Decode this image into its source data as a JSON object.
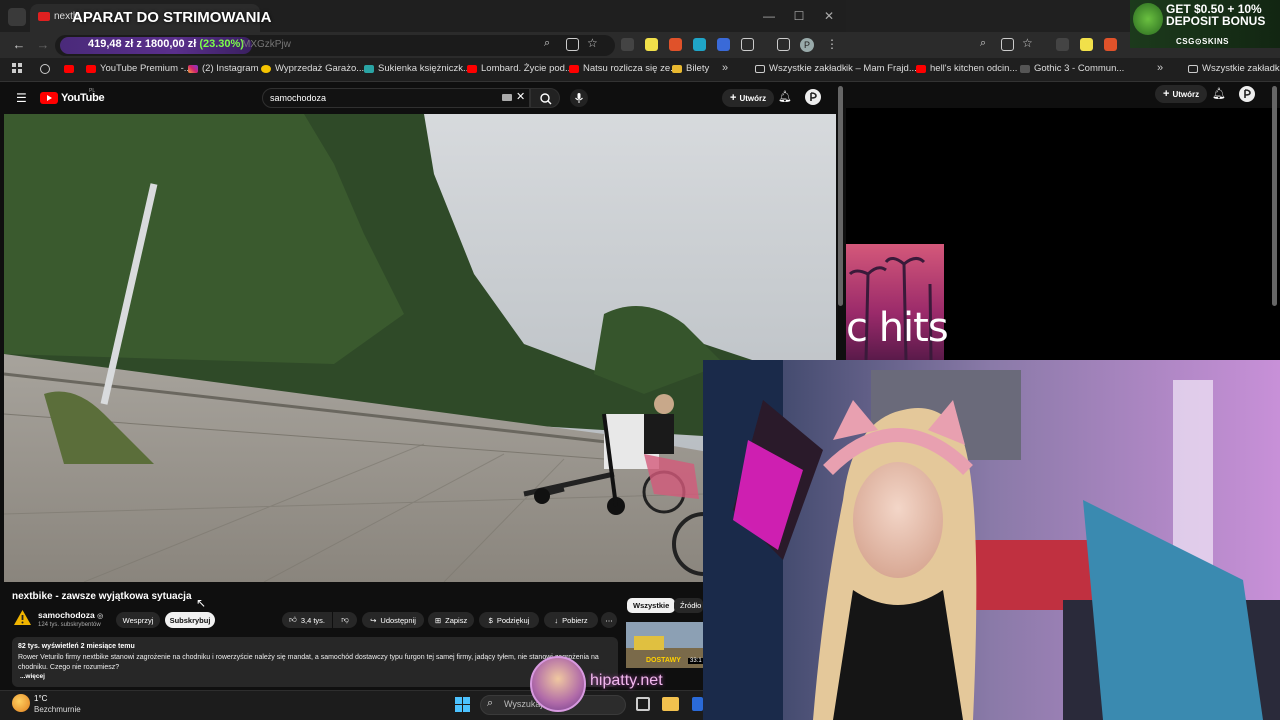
{
  "browser": {
    "tab_title": "nextb",
    "overlay_title": "APARAT DO STRIMOWANIA",
    "price_extension": {
      "price": "419,48 zł",
      "from": "z 1800,00 zł",
      "gain": "(23.30%)"
    },
    "url_tail": "MXGzkPjw",
    "profile_letter": "P",
    "bookmarks": [
      "YouTube Premium -...",
      "(2) Instagram",
      "Wyprzedaż Garażo...",
      "Sukienka księżniczk...",
      "Lombard. Życie pod...",
      "Natsu rozlicza się ze...",
      "Bilety"
    ],
    "bookmarks_all": "Wszystkie zakładki"
  },
  "youtube": {
    "logo": "YouTube",
    "logo_region": "PL",
    "search_value": "samochodoza",
    "create_label": "Utwórz"
  },
  "video": {
    "title": "nextbike - zawsze wyjątkowa sytuacja",
    "channel": "samochodoza",
    "subscribers": "124 tys. subskrybentów",
    "support_label": "Wesprzyj",
    "subscribe_label": "Subskrybuj",
    "likes": "3,4 tys.",
    "share_label": "Udostępnij",
    "save_label": "Zapisz",
    "thanks_label": "Podziękuj",
    "download_label": "Pobierz",
    "description": {
      "meta": "82 tys. wyświetleń  2 miesiące temu",
      "text": "Rower Veturilo firmy nextbike stanowi zagrożenie na chodniku i rowerzyście należy się mandat, a samochód dostawczy typu furgon tej samej firmy, jadący tyłem, nie stanowi zagrożenia na chodniku. Czego nie rozumiesz?",
      "more": "...więcej"
    },
    "chips": [
      "Wszystkie",
      "Źródło"
    ],
    "side_thumb_duration": "33:1"
  },
  "right_window": {
    "bookmarks": [
      "ik – Mam Frajd...",
      "hell's kitchen odcin...",
      "Gothic 3 - Commun..."
    ],
    "bookmarks_all": "Wszystkie zakładki",
    "create_label": "Utwórz",
    "thumb_text": "c hits"
  },
  "ad": {
    "line1": "GET $0.50 + 10%",
    "line2": "DEPOSIT BONUS",
    "brand": "CSG⊙SKINS"
  },
  "taskbar": {
    "temperature": "1°C",
    "weather": "Bezchmurnie",
    "search_placeholder": "Wyszukaj"
  },
  "stream": {
    "watermark": "hipatty.net"
  },
  "colors": {
    "yt_red": "#ff0000",
    "gain_green": "#7cff4a",
    "price_chip": "#5a2f8c",
    "watermark_pink": "#f2b8ee"
  }
}
